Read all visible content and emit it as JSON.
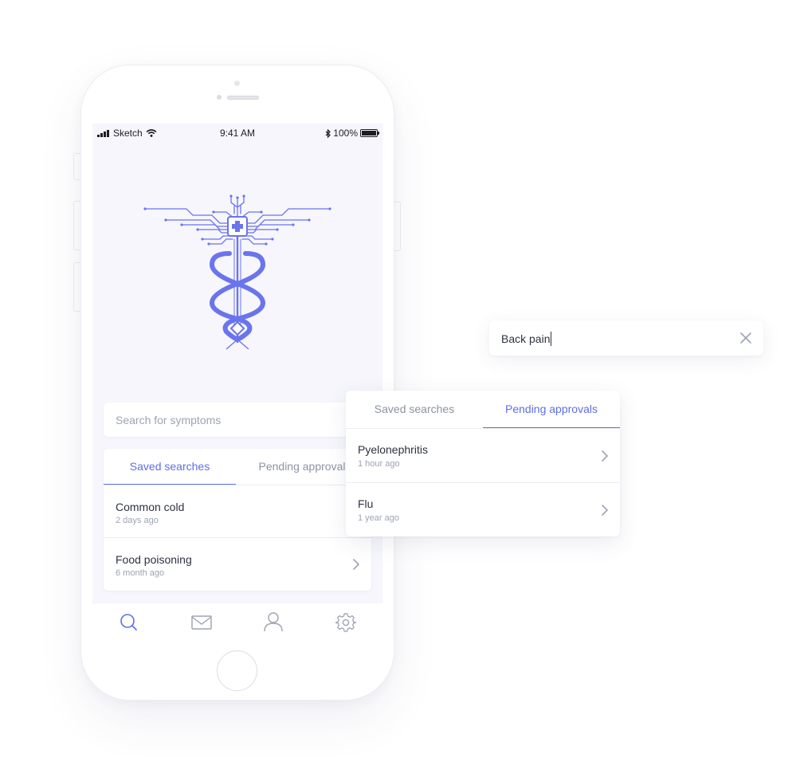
{
  "status_bar": {
    "carrier": "Sketch",
    "time": "9:41 AM",
    "battery": "100%",
    "icons": [
      "signal-icon",
      "wifi-icon",
      "bluetooth-icon",
      "battery-icon"
    ]
  },
  "logo": {
    "icon": "caduceus-circuit-icon",
    "color": "#6a74ec"
  },
  "search": {
    "placeholder": "Search for symptoms"
  },
  "phone_list": {
    "tabs": [
      {
        "label": "Saved searches",
        "active": true
      },
      {
        "label": "Pending approval",
        "active": false
      }
    ],
    "items": [
      {
        "title": "Common cold",
        "subtitle": "2 days ago"
      },
      {
        "title": "Food poisoning",
        "subtitle": "6 month ago"
      }
    ]
  },
  "tabbar": {
    "items": [
      {
        "icon": "search-icon",
        "active": true
      },
      {
        "icon": "mail-icon",
        "active": false
      },
      {
        "icon": "profile-icon",
        "active": false
      },
      {
        "icon": "settings-icon",
        "active": false
      }
    ]
  },
  "float_search": {
    "value": "Back pain",
    "clear_icon": "close-icon"
  },
  "float_list": {
    "tabs": [
      {
        "label": "Saved searches",
        "active": false
      },
      {
        "label": "Pending approvals",
        "active": true
      }
    ],
    "items": [
      {
        "title": "Pyelonephritis",
        "subtitle": "1 hour ago"
      },
      {
        "title": "Flu",
        "subtitle": "1 year ago"
      }
    ]
  },
  "colors": {
    "accent": "#5f6ee8",
    "screen_bg": "#f6f6fc",
    "muted_text": "#9ea3b4"
  }
}
